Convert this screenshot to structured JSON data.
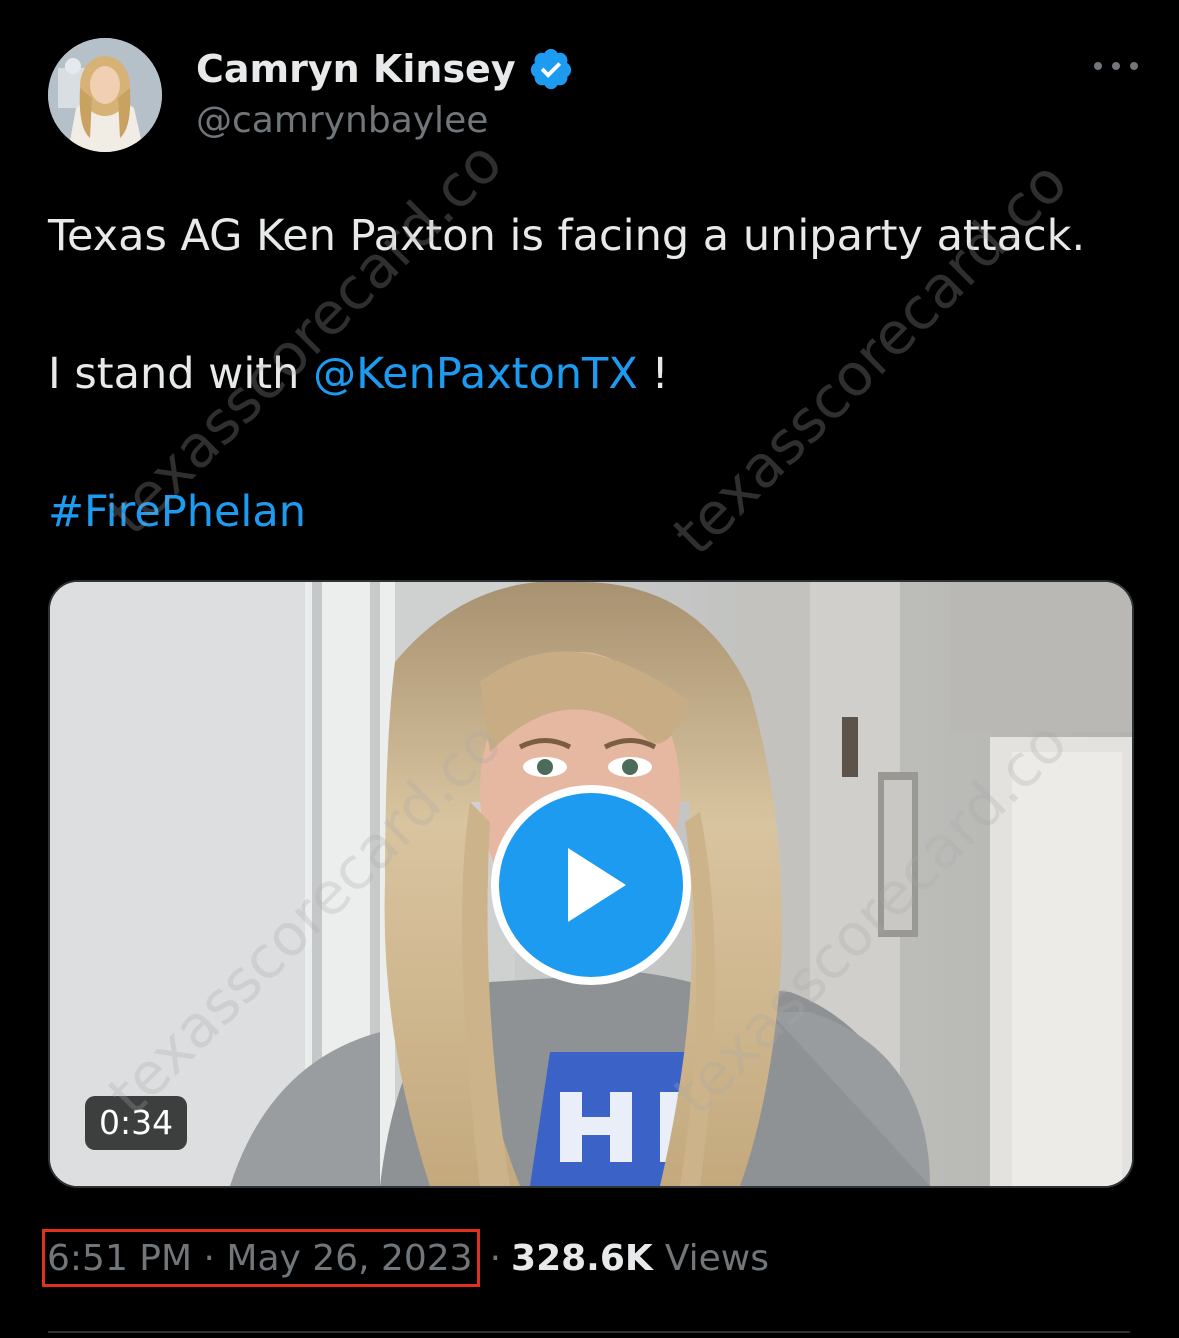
{
  "author": {
    "display_name": "Camryn Kinsey",
    "handle": "@camrynbaylee",
    "verified": true
  },
  "tweet": {
    "text_line1": "Texas AG Ken Paxton is facing a uniparty attack.",
    "text_line2_prefix": "I stand with ",
    "mention": "@KenPaxtonTX",
    "text_line2_suffix": " !",
    "hashtag": "#FirePhelan"
  },
  "media": {
    "duration": "0:34"
  },
  "meta": {
    "timestamp": "6:51 PM · May 26, 2023",
    "separator": "·",
    "views_count": "328.6K",
    "views_label": "Views"
  },
  "watermark": "texasscorecard.co",
  "colors": {
    "background": "#000000",
    "text": "#e7e9ea",
    "muted": "#71767b",
    "link": "#1d9bf0",
    "highlight_box": "#e0301e"
  },
  "icons": {
    "verified": "verified-badge-icon",
    "more": "more-options-icon",
    "play": "play-icon"
  }
}
